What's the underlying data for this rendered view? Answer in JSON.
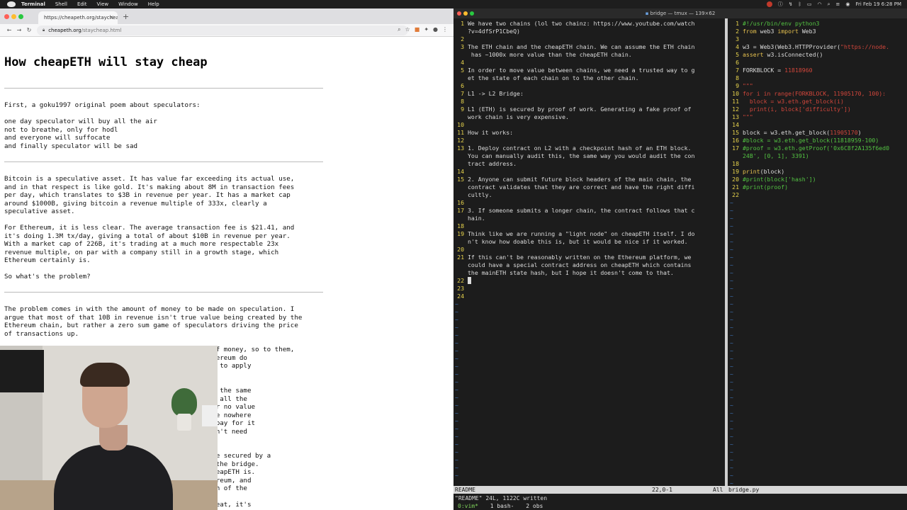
{
  "menubar": {
    "items": [
      "Terminal",
      "Shell",
      "Edit",
      "View",
      "Window",
      "Help"
    ],
    "clock": "Fri Feb 19 6:28 PM"
  },
  "browser": {
    "tab_title": "https://cheapeth.org/staychea",
    "url_host": "cheapeth.org",
    "url_path": "/staycheap.html",
    "page": {
      "title": "How cheapETH will stay cheap",
      "paragraphs": [
        "First, a goku1997 original poem about speculators:",
        "one day speculator will buy all the air\nnot to breathe, only for hodl\nand everyone will suffocate\nand finally speculator will be sad",
        "Bitcoin is a speculative asset. It has value far exceeding its actual use,\nand in that respect is like gold. It's making about 8M in transaction fees\nper day, which translates to $3B in revenue per year. It has a market cap\naround $1000B, giving bitcoin a revenue multiple of 333x, clearly a\nspeculative asset.",
        "For Ethereum, it is less clear. The average transaction fee is $21.41, and\nit's doing 1.3M tx/day, giving a total of about $10B in revenue per year.\nWith a market cap of 226B, it's trading at a much more respectable 23x\nrevenue multiple, on par with a company still in a growth stage, which\nEthereum certainly is.",
        "So what's the problem?",
        "The problem comes in with the amount of money to be made on speculation. I\nargue that most of that 10B in revenue isn't true value being created by the\nEthereum chain, but rather a zero sum game of speculators driving the price\nof transactions up.",
        "And these speculators are moving around huge amounts of money, so to them,\n                                        on fees on Ethereum do\n                                        here was a way to apply",
        "                                        g of doing all the same\n                                        te of securing all the\n                                        lower value, or no value\n                                        actions require nowhere\n                                         yet they all pay for it\n                                        r it if you don't need",
        "                                        L2 to L1 bridge secured by a\n                                        ees for using the bridge.\n                                        lateralized cheapETH is.\n                                        Just like Ethereum, and\n                                        at about 1/10th of the",
        "                                        1/1000 ETH, great, it's"
      ]
    }
  },
  "terminal": {
    "title": "bridge — tmux — 139×62",
    "readme_lines": [
      {
        "n": "1",
        "t": "We have two chains (lol two chainz: https://www.youtube.com/watch"
      },
      {
        "n": "",
        "t": "?v=4dfSrP1CbeQ)"
      },
      {
        "n": "2",
        "t": ""
      },
      {
        "n": "3",
        "t": "The ETH chain and the cheapETH chain. We can assume the ETH chain"
      },
      {
        "n": "",
        "t": " has ~1000x more value than the cheapETH chain."
      },
      {
        "n": "4",
        "t": ""
      },
      {
        "n": "5",
        "t": "In order to move value between chains, we need a trusted way to g"
      },
      {
        "n": "",
        "t": "et the state of each chain on to the other chain."
      },
      {
        "n": "6",
        "t": ""
      },
      {
        "n": "7",
        "t": "L1 -> L2 Bridge:"
      },
      {
        "n": "8",
        "t": ""
      },
      {
        "n": "9",
        "t": "L1 (ETH) is secured by proof of work. Generating a fake proof of"
      },
      {
        "n": "",
        "t": "work chain is very expensive."
      },
      {
        "n": "10",
        "t": ""
      },
      {
        "n": "11",
        "t": "How it works:"
      },
      {
        "n": "12",
        "t": ""
      },
      {
        "n": "13",
        "t": "1. Deploy contract on L2 with a checkpoint hash of an ETH block."
      },
      {
        "n": "",
        "t": "You can manually audit this, the same way you would audit the con"
      },
      {
        "n": "",
        "t": "tract address."
      },
      {
        "n": "14",
        "t": ""
      },
      {
        "n": "15",
        "t": "2. Anyone can submit future block headers of the main chain, the"
      },
      {
        "n": "",
        "t": "contract validates that they are correct and have the right diffi"
      },
      {
        "n": "",
        "t": "cultly."
      },
      {
        "n": "16",
        "t": ""
      },
      {
        "n": "17",
        "t": "3. If someone submits a longer chain, the contract follows that c"
      },
      {
        "n": "",
        "t": "hain."
      },
      {
        "n": "18",
        "t": ""
      },
      {
        "n": "19",
        "t": "Think like we are running a \"light node\" on cheapETH itself. I do"
      },
      {
        "n": "",
        "t": "n't know how doable this is, but it would be nice if it worked."
      },
      {
        "n": "20",
        "t": ""
      },
      {
        "n": "21",
        "t": "If this can't be reasonably written on the Ethereum platform, we"
      },
      {
        "n": "",
        "t": "could have a special contract address on cheapETH which contains"
      },
      {
        "n": "",
        "t": "the mainETH state hash, but I hope it doesn't come to that."
      },
      {
        "n": "22",
        "t": ""
      },
      {
        "n": "23",
        "t": ""
      },
      {
        "n": "24",
        "t": ""
      }
    ],
    "bridge_lines": [
      {
        "n": "1",
        "parts": [
          {
            "c": "green",
            "t": "#!/usr/bin/env python3"
          }
        ]
      },
      {
        "n": "2",
        "parts": [
          {
            "c": "kw",
            "t": "from "
          },
          {
            "c": "plain",
            "t": "web3 "
          },
          {
            "c": "kw",
            "t": "import "
          },
          {
            "c": "plain",
            "t": "Web3"
          }
        ]
      },
      {
        "n": "3",
        "parts": []
      },
      {
        "n": "4",
        "parts": [
          {
            "c": "plain",
            "t": "w3 = Web3(Web3.HTTPProvider("
          },
          {
            "c": "str",
            "t": "\"https://node."
          }
        ]
      },
      {
        "n": "5",
        "parts": [
          {
            "c": "kw",
            "t": "assert "
          },
          {
            "c": "plain",
            "t": "w3.isConnected()"
          }
        ]
      },
      {
        "n": "6",
        "parts": []
      },
      {
        "n": "7",
        "parts": [
          {
            "c": "plain",
            "t": "FORKBLOCK = "
          },
          {
            "c": "num",
            "t": "11818960"
          }
        ]
      },
      {
        "n": "8",
        "parts": []
      },
      {
        "n": "9",
        "parts": [
          {
            "c": "cmt",
            "t": "\"\"\""
          }
        ]
      },
      {
        "n": "10",
        "parts": [
          {
            "c": "cmt",
            "t": "for i in range(FORKBLOCK, 11905170, 100):"
          }
        ]
      },
      {
        "n": "11",
        "parts": [
          {
            "c": "cmt",
            "t": "  block = w3.eth.get_block(i)"
          }
        ]
      },
      {
        "n": "12",
        "parts": [
          {
            "c": "cmt",
            "t": "  print(i, block['difficulty'])"
          }
        ]
      },
      {
        "n": "13",
        "parts": [
          {
            "c": "cmt",
            "t": "\"\"\""
          }
        ]
      },
      {
        "n": "14",
        "parts": []
      },
      {
        "n": "15",
        "parts": [
          {
            "c": "plain",
            "t": "block = w3.eth.get_block("
          },
          {
            "c": "num",
            "t": "11905170"
          },
          {
            "c": "plain",
            "t": ")"
          }
        ]
      },
      {
        "n": "16",
        "parts": [
          {
            "c": "green",
            "t": "#block = w3.eth.get_block(11818959-100)"
          }
        ]
      },
      {
        "n": "17",
        "parts": [
          {
            "c": "green",
            "t": "#proof = w3.eth.getProof('0x6C8f2A135f6ed0"
          }
        ]
      },
      {
        "n": "",
        "parts": [
          {
            "c": "green",
            "t": "24B', [0, 1], 3391)"
          }
        ]
      },
      {
        "n": "18",
        "parts": []
      },
      {
        "n": "19",
        "parts": [
          {
            "c": "fn",
            "t": "print"
          },
          {
            "c": "plain",
            "t": "(block)"
          }
        ]
      },
      {
        "n": "20",
        "parts": [
          {
            "c": "green",
            "t": "#print(block['hash'])"
          }
        ]
      },
      {
        "n": "21",
        "parts": [
          {
            "c": "green",
            "t": "#print(proof)"
          }
        ]
      },
      {
        "n": "22",
        "parts": []
      }
    ],
    "status": {
      "file": "README",
      "pos": "22,0-1",
      "scroll": "All",
      "right_file": "bridge.py"
    },
    "cmdline": "\"README\" 24L, 1122C written",
    "tmux_windows": [
      "0:vim*",
      "1 bash-",
      "2 obs"
    ]
  }
}
